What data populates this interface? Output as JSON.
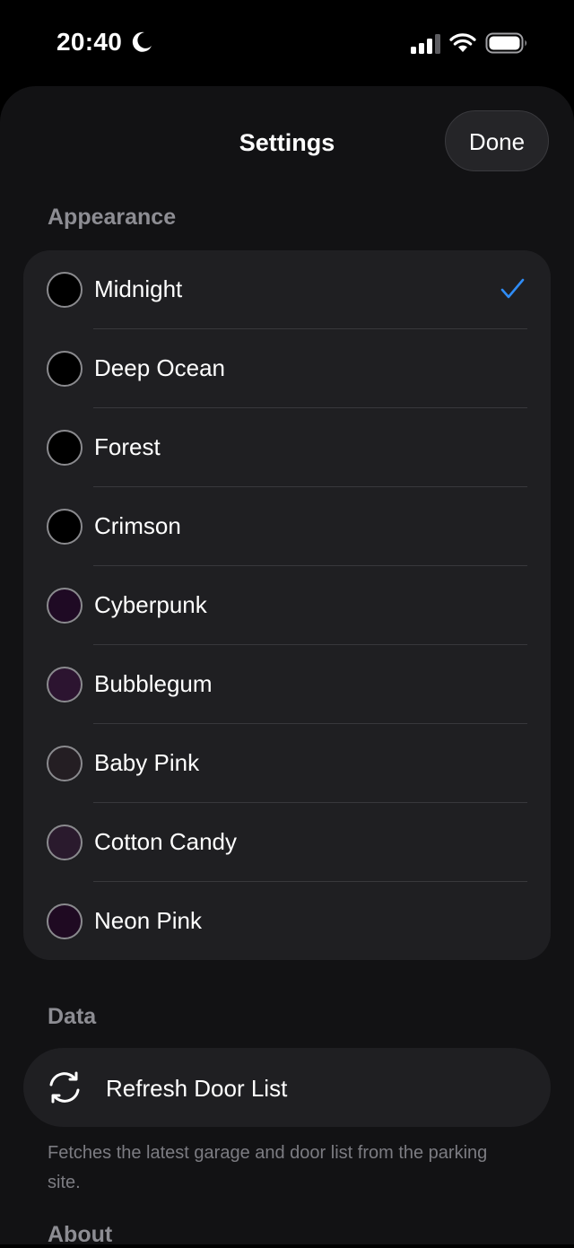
{
  "status_bar": {
    "time": "20:40",
    "icons": [
      "moon-icon",
      "cellular-signal-icon",
      "wifi-icon",
      "battery-icon"
    ]
  },
  "nav": {
    "title": "Settings",
    "done_label": "Done"
  },
  "appearance": {
    "header": "Appearance",
    "selected": "Midnight",
    "accent_color": "#2f8cf6",
    "themes": [
      {
        "label": "Midnight",
        "swatch": "#000000"
      },
      {
        "label": "Deep Ocean",
        "swatch": "#000000"
      },
      {
        "label": "Forest",
        "swatch": "#000000"
      },
      {
        "label": "Crimson",
        "swatch": "#000000"
      },
      {
        "label": "Cyberpunk",
        "swatch": "#1f0a24"
      },
      {
        "label": "Bubblegum",
        "swatch": "#2c1430"
      },
      {
        "label": "Baby Pink",
        "swatch": "#241e23"
      },
      {
        "label": "Cotton Candy",
        "swatch": "#2a1a2d"
      },
      {
        "label": "Neon Pink",
        "swatch": "#1f0a22"
      }
    ]
  },
  "data_section": {
    "header": "Data",
    "refresh_label": "Refresh Door List",
    "footnote": "Fetches the latest garage and door list from the parking site."
  },
  "about_section": {
    "header": "About"
  }
}
